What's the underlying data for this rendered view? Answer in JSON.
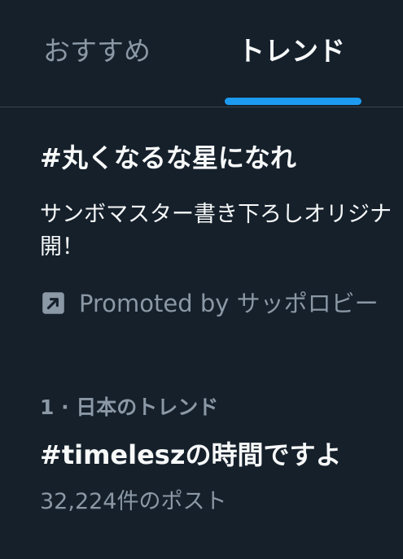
{
  "tabs": {
    "recommended": "おすすめ",
    "trends": "トレンド",
    "active": "trends"
  },
  "promoted_trend": {
    "title": "#丸くなるな星になれ",
    "description_line1": "サンボマスター書き下ろしオリジナ",
    "description_line2": "開！",
    "promoted_label": "Promoted by サッポロビー",
    "icon": "promoted-arrow-icon"
  },
  "trend": {
    "meta": "1 · 日本のトレンド",
    "title": "#timeleszの時間ですよ",
    "post_count": "32,224件のポスト"
  },
  "colors": {
    "background": "#15202b",
    "primary_text": "#f7f9f9",
    "secondary_text": "#8b98a5",
    "accent": "#1d9bf0",
    "divider": "#38444d"
  }
}
